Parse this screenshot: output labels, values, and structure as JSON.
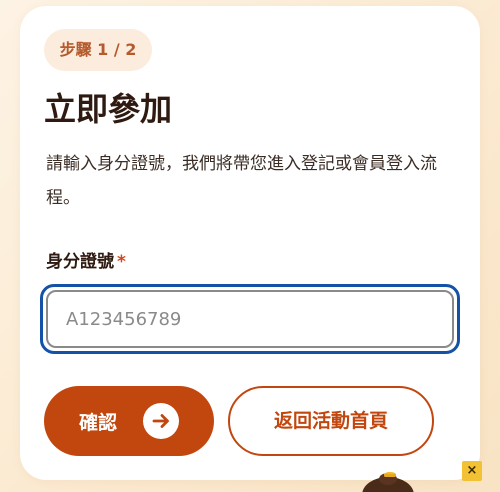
{
  "step": {
    "label": "步驟 1 / 2"
  },
  "header": {
    "title": "立即參加"
  },
  "intro": {
    "description": "請輸入身分證號，我們將帶您進入登記或會員登入流程。"
  },
  "form": {
    "id_label": "身分證號",
    "required_marker": "*",
    "id_value": "",
    "id_placeholder": "A123456789"
  },
  "actions": {
    "confirm_label": "確認",
    "confirm_icon": "arrow-right-icon",
    "back_label": "返回活動首頁"
  },
  "overlay": {
    "close_glyph": "×"
  },
  "colors": {
    "accent": "#c2470f",
    "focus_ring": "#1452a8",
    "badge_bg": "#fbecdd",
    "title_text": "#2e1a10",
    "required": "#d2451f",
    "close_button": "#f2c234"
  }
}
